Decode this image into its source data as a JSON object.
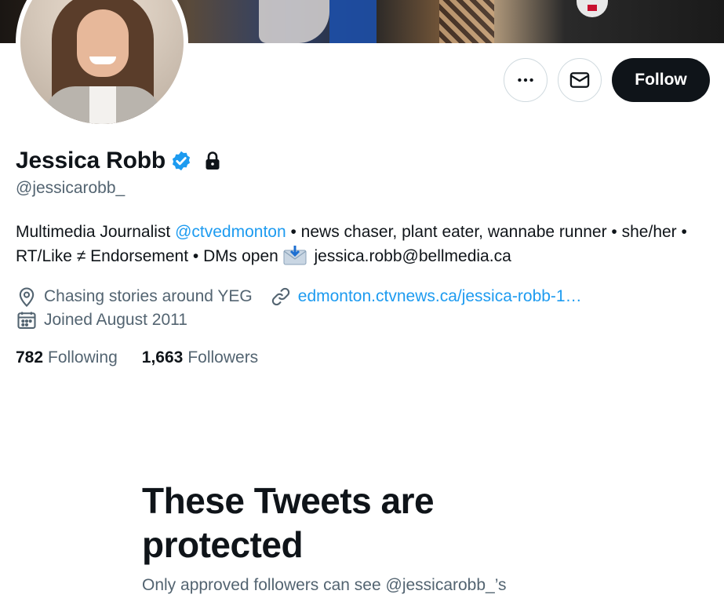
{
  "banner": {
    "description_icon": "banner-image"
  },
  "profile": {
    "name": "Jessica Robb",
    "handle": "@jessicarobb_",
    "verified": true,
    "protected": true
  },
  "actions": {
    "more_icon": "more-icon",
    "message_icon": "mail-icon",
    "follow_label": "Follow"
  },
  "bio": {
    "part1": "Multimedia Journalist ",
    "mention": "@ctvedmonton",
    "part2": " • news chaser, plant eater, wannabe runner • she/her • RT/Like ≠ Endorsement • DMs open ",
    "part3": " jessica.robb@bellmedia.ca"
  },
  "meta": {
    "location": "Chasing stories around YEG",
    "website": "edmonton.ctvnews.ca/jessica-robb-1…",
    "joined": "Joined August 2011"
  },
  "stats": {
    "following_count": "782",
    "following_label": "Following",
    "followers_count": "1,663",
    "followers_label": "Followers"
  },
  "protected_notice": {
    "title": "These Tweets are protected",
    "subtitle": "Only approved followers can see @jessicarobb_’s"
  },
  "colors": {
    "accent": "#1d9bf0",
    "text_primary": "#0f1419",
    "text_secondary": "#536471",
    "follow_button_bg": "#0f1419"
  }
}
